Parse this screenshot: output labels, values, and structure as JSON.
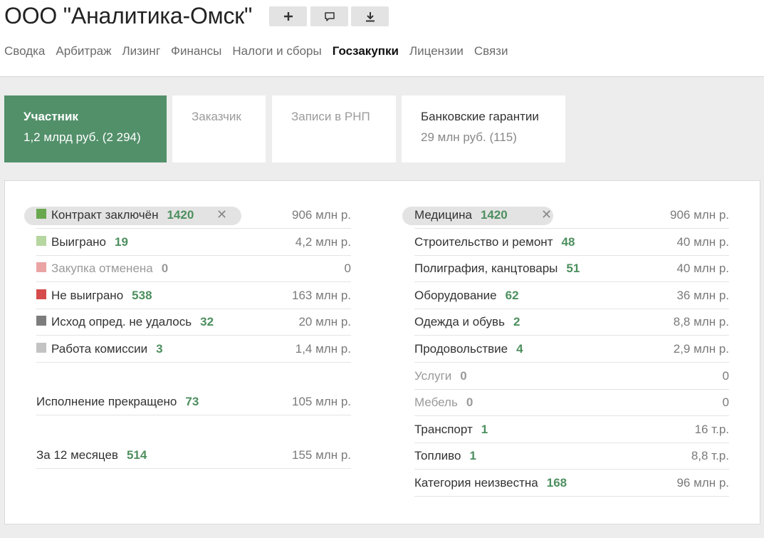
{
  "header": {
    "company_name": "ООО \"Аналитика-Омск\"",
    "actions": [
      {
        "name": "add-button",
        "icon": "plus-icon"
      },
      {
        "name": "comment-button",
        "icon": "comment-icon"
      },
      {
        "name": "download-button",
        "icon": "download-icon"
      }
    ],
    "nav": [
      "Сводка",
      "Арбитраж",
      "Лизинг",
      "Финансы",
      "Налоги и сборы",
      "Госзакупки",
      "Лицензии",
      "Связи"
    ],
    "active_nav": "Госзакупки"
  },
  "cards": [
    {
      "title": "Участник",
      "subtitle": "1,2 млрд руб. (2 294)",
      "active": true
    },
    {
      "title": "Заказчик",
      "subtitle": "",
      "active": false
    },
    {
      "title": "Записи в РНП",
      "subtitle": "",
      "active": false
    },
    {
      "title": "Банковские гарантии",
      "subtitle": "29 млн руб. (115)",
      "active": false
    }
  ],
  "status_rows": [
    {
      "label": "Контракт заключён",
      "count": "1420",
      "amount": "906 млн р.",
      "color": "#6aa84f",
      "selected": true
    },
    {
      "label": "Выиграно",
      "count": "19",
      "amount": "4,2 млн р.",
      "color": "#b6d7a0"
    },
    {
      "label": "Закупка отменена",
      "count": "0",
      "amount": "0",
      "color": "#eaa4a4",
      "muted": true
    },
    {
      "label": "Не выиграно",
      "count": "538",
      "amount": "163 млн р.",
      "color": "#d64b4b"
    },
    {
      "label": "Исход опред. не удалось",
      "count": "32",
      "amount": "20 млн р.",
      "color": "#7d7d7d"
    },
    {
      "label": "Работа комиссии",
      "count": "3",
      "amount": "1,4 млн р.",
      "color": "#c3c3c3"
    }
  ],
  "extra_rows": [
    {
      "label": "Исполнение прекращено",
      "count": "73",
      "amount": "105 млн р."
    },
    {
      "label": "За 12 месяцев",
      "count": "514",
      "amount": "155 млн р."
    }
  ],
  "category_rows": [
    {
      "label": "Медицина",
      "count": "1420",
      "amount": "906 млн р.",
      "selected": true
    },
    {
      "label": "Строительство и ремонт",
      "count": "48",
      "amount": "40 млн р."
    },
    {
      "label": "Полиграфия, канцтовары",
      "count": "51",
      "amount": "40 млн р."
    },
    {
      "label": "Оборудование",
      "count": "62",
      "amount": "36 млн р."
    },
    {
      "label": "Одежда и обувь",
      "count": "2",
      "amount": "8,8 млн р."
    },
    {
      "label": "Продовольствие",
      "count": "4",
      "amount": "2,9 млн р."
    },
    {
      "label": "Услуги",
      "count": "0",
      "amount": "0",
      "muted": true
    },
    {
      "label": "Мебель",
      "count": "0",
      "amount": "0",
      "muted": true
    },
    {
      "label": "Транспорт",
      "count": "1",
      "amount": "16 т.р."
    },
    {
      "label": "Топливо",
      "count": "1",
      "amount": "8,8 т.р."
    },
    {
      "label": "Категория неизвестна",
      "count": "168",
      "amount": "96 млн р."
    }
  ],
  "clear_filter_symbol": "✕"
}
